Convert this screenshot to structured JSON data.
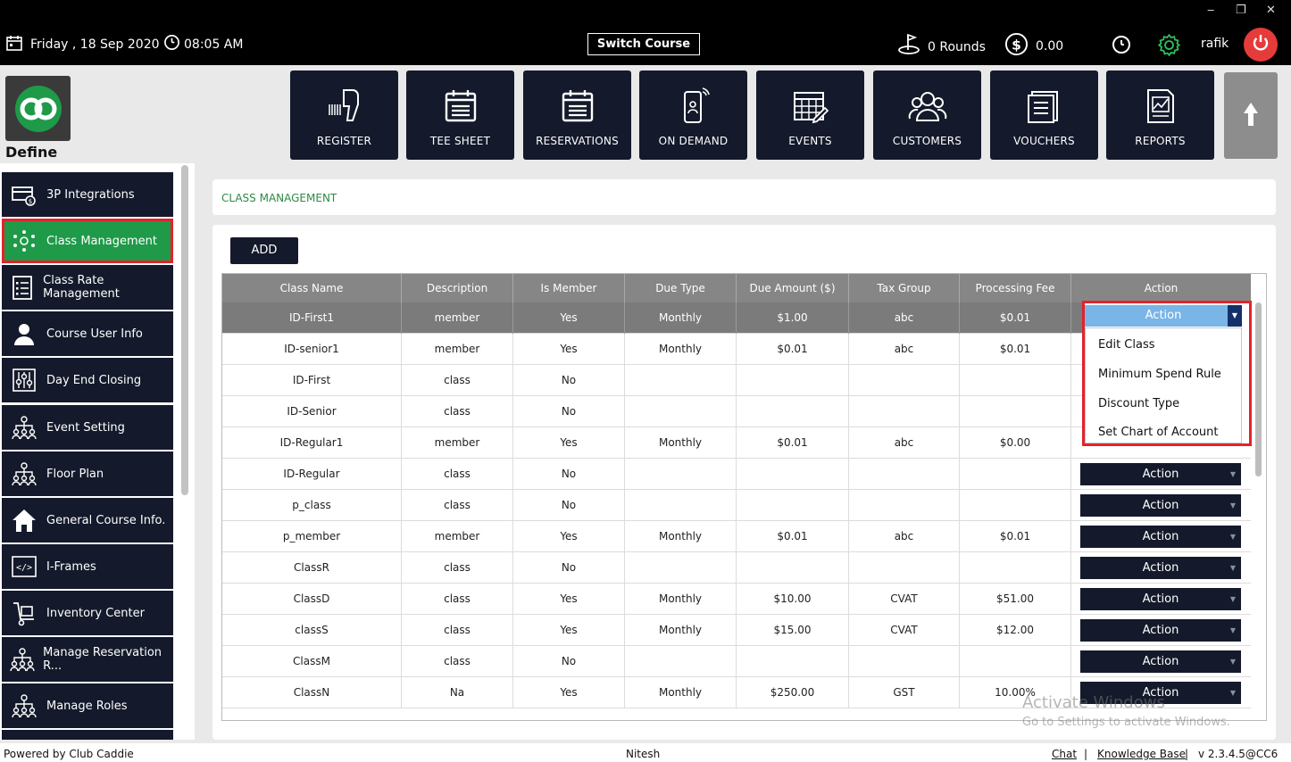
{
  "topbar": {
    "date": "Friday ,  18 Sep 2020",
    "time": "08:05 AM",
    "switch_course": "Switch Course",
    "rounds": "0 Rounds",
    "balance": "0.00",
    "user": "rafik",
    "win_min": "‒",
    "win_restore": "❐",
    "win_close": "✕"
  },
  "header": {
    "define_label": "Define",
    "nav": [
      {
        "label": "REGISTER",
        "icon": "barcode-scanner-icon"
      },
      {
        "label": "TEE SHEET",
        "icon": "calendar-list-icon"
      },
      {
        "label": "RESERVATIONS",
        "icon": "calendar-list-icon"
      },
      {
        "label": "ON DEMAND",
        "icon": "mobile-phone-icon"
      },
      {
        "label": "EVENTS",
        "icon": "calendar-edit-icon"
      },
      {
        "label": "CUSTOMERS",
        "icon": "people-icon"
      },
      {
        "label": "VOUCHERS",
        "icon": "voucher-list-icon"
      },
      {
        "label": "REPORTS",
        "icon": "report-chart-icon"
      }
    ]
  },
  "sidebar": {
    "items": [
      {
        "label": "3P Integrations"
      },
      {
        "label": "Class Management"
      },
      {
        "label": "Class Rate Management"
      },
      {
        "label": "Course User Info"
      },
      {
        "label": "Day End Closing"
      },
      {
        "label": "Event Setting"
      },
      {
        "label": "Floor Plan"
      },
      {
        "label": "General Course Info."
      },
      {
        "label": "I-Frames"
      },
      {
        "label": "Inventory Center"
      },
      {
        "label": "Manage Reservation R..."
      },
      {
        "label": "Manage Roles"
      }
    ]
  },
  "main": {
    "breadcrumb": "CLASS MANAGEMENT",
    "add_label": "ADD",
    "columns": [
      "Class Name",
      "Description",
      "Is Member",
      "Due Type",
      "Due Amount ($)",
      "Tax Group",
      "Processing Fee",
      "Action"
    ],
    "rows": [
      [
        "ID-First1",
        "member",
        "Yes",
        "Monthly",
        "$1.00",
        "abc",
        "$0.01"
      ],
      [
        "ID-senior1",
        "member",
        "Yes",
        "Monthly",
        "$0.01",
        "abc",
        "$0.01"
      ],
      [
        "ID-First",
        "class",
        "No",
        "",
        "",
        "",
        ""
      ],
      [
        "ID-Senior",
        "class",
        "No",
        "",
        "",
        "",
        ""
      ],
      [
        "ID-Regular1",
        "member",
        "Yes",
        "Monthly",
        "$0.01",
        "abc",
        "$0.00"
      ],
      [
        "ID-Regular",
        "class",
        "No",
        "",
        "",
        "",
        ""
      ],
      [
        "p_class",
        "class",
        "No",
        "",
        "",
        "",
        ""
      ],
      [
        "p_member",
        "member",
        "Yes",
        "Monthly",
        "$0.01",
        "abc",
        "$0.01"
      ],
      [
        "ClassR",
        "class",
        "No",
        "",
        "",
        "",
        ""
      ],
      [
        "ClassD",
        "class",
        "Yes",
        "Monthly",
        "$10.00",
        "CVAT",
        "$51.00"
      ],
      [
        "classS",
        "class",
        "Yes",
        "Monthly",
        "$15.00",
        "CVAT",
        "$12.00"
      ],
      [
        "ClassM",
        "class",
        "No",
        "",
        "",
        "",
        ""
      ],
      [
        "ClassN",
        "Na",
        "Yes",
        "Monthly",
        "$250.00",
        "GST",
        "10.00%"
      ]
    ],
    "action_label": "Action",
    "dropdown": {
      "selected": "Action",
      "options": [
        "Edit Class",
        "Minimum Spend Rule",
        "Discount Type",
        "Set Chart of Account"
      ]
    },
    "watermark_title": "Activate Windows",
    "watermark_sub": "Go to Settings to activate Windows."
  },
  "footer": {
    "powered": "Powered by Club Caddie",
    "center": "Nitesh",
    "chat": "Chat",
    "kb": "Knowledge Base",
    "version": "v 2.3.4.5@CC6",
    "sep": "|"
  },
  "colors": {
    "dark_navy": "#141a2b",
    "green_active": "#1e9a48",
    "red_highlight": "#e3232b",
    "dropdown_blue": "#79b5e6"
  }
}
